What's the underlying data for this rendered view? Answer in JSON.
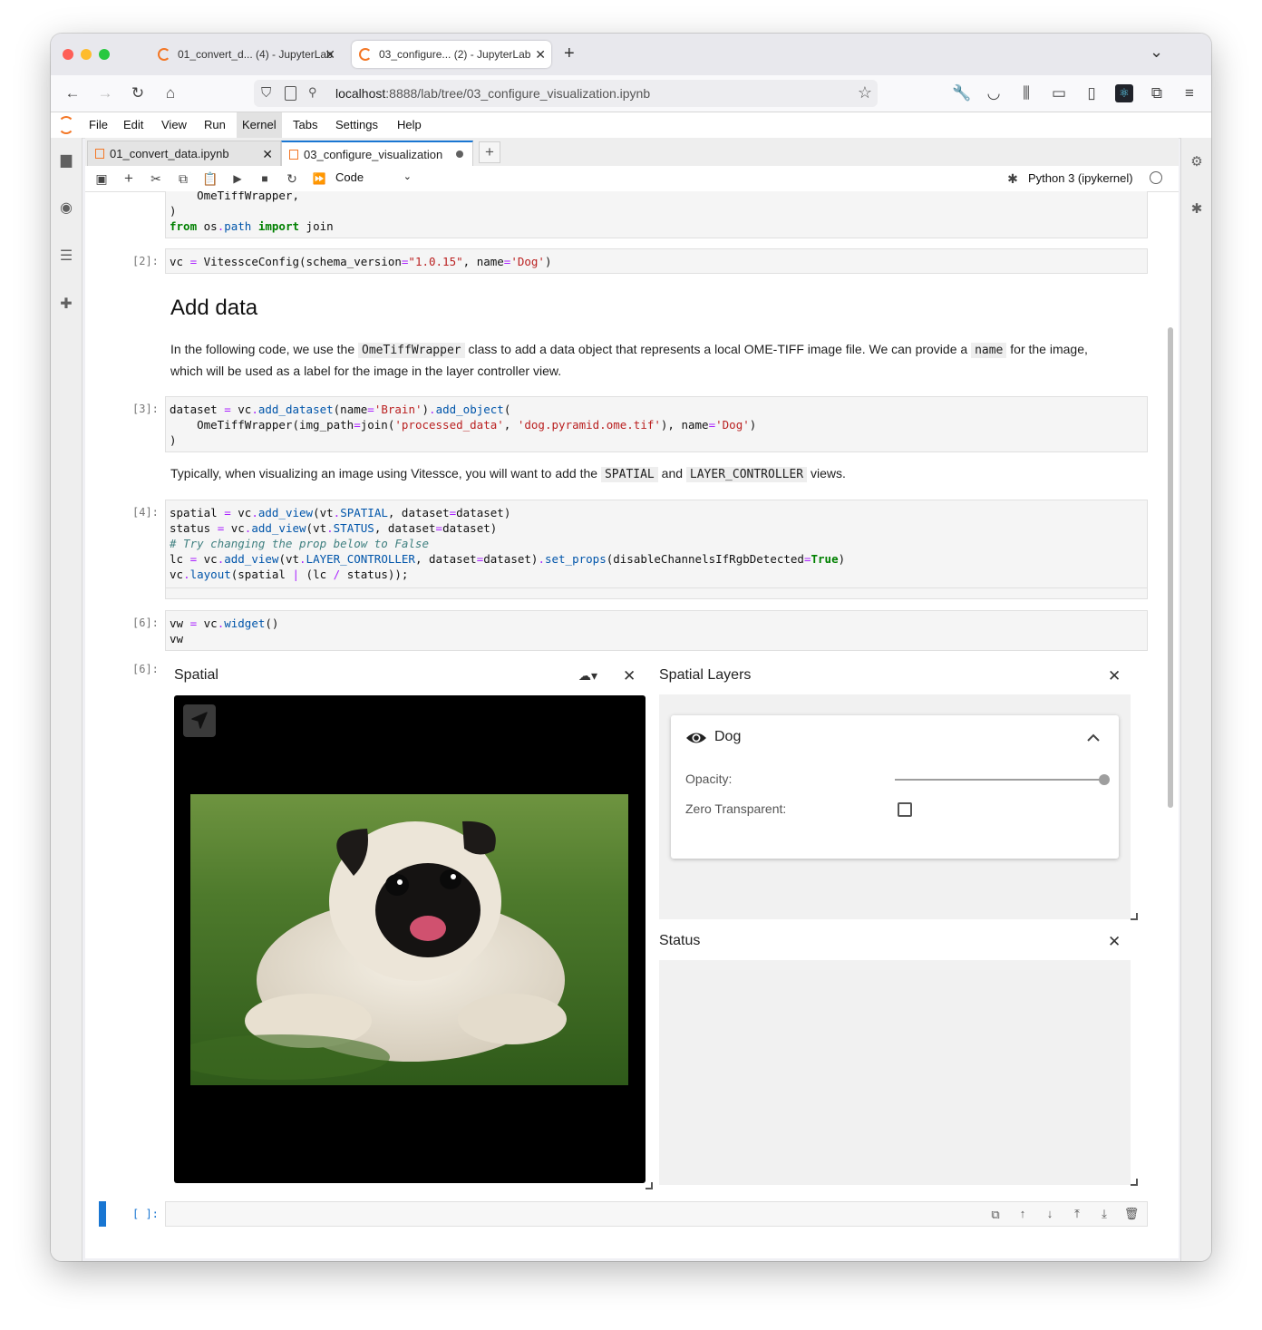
{
  "browser": {
    "tabs": [
      {
        "label": "01_convert_d... (4) - JupyterLab",
        "active": false
      },
      {
        "label": "03_configure... (2) - JupyterLab",
        "active": true
      }
    ],
    "new_tab": "+",
    "tab_list": "⌄",
    "url_prefix": "localhost",
    "url_rest": ":8888/lab/tree/03_configure_visualization.ipynb"
  },
  "jupyter": {
    "menus": [
      "File",
      "Edit",
      "View",
      "Run",
      "Kernel",
      "Tabs",
      "Settings",
      "Help"
    ],
    "active_menu": "Kernel",
    "doc_tabs": [
      {
        "label": "01_convert_data.ipynb",
        "active": false
      },
      {
        "label": "03_configure_visualization",
        "active": true
      }
    ],
    "doc_tab_add": "+",
    "cell_type": "Code",
    "kernel": "Python 3 (ipykernel)"
  },
  "cells": {
    "cell0_line1": "    OmeTiffWrapper,",
    "cell0_line2": ")",
    "prompt2": "[2]:",
    "prompt3": "[3]:",
    "prompt4": "[4]:",
    "prompt6_in": "[6]:",
    "prompt6_out": "[6]:",
    "prompt_empty": "[ ]:",
    "heading": "Add data",
    "md1": {
      "t1": "In the following code, we use the ",
      "c1": "OmeTiffWrapper",
      "t2": " class to add a data object that represents a local OME-TIFF image file. We can provide a ",
      "c2": "name",
      "t3": " for the image, which will be used as a label for the image in the layer controller view."
    },
    "md2": {
      "t1": "Typically, when visualizing an image using Vitessce, you will want to add the ",
      "c1": "SPATIAL",
      "t2": " and ",
      "c2": "LAYER_CONTROLLER",
      "t3": " views."
    }
  },
  "widget": {
    "spatial_title": "Spatial",
    "layers_title": "Spatial Layers",
    "layer_name": "Dog",
    "opacity_label": "Opacity:",
    "opacity_value": 1.0,
    "zero_transparent_label": "Zero Transparent:",
    "status_title": "Status"
  },
  "colors": {
    "accent": "#1976d2",
    "jupyter_orange": "#f37726"
  }
}
